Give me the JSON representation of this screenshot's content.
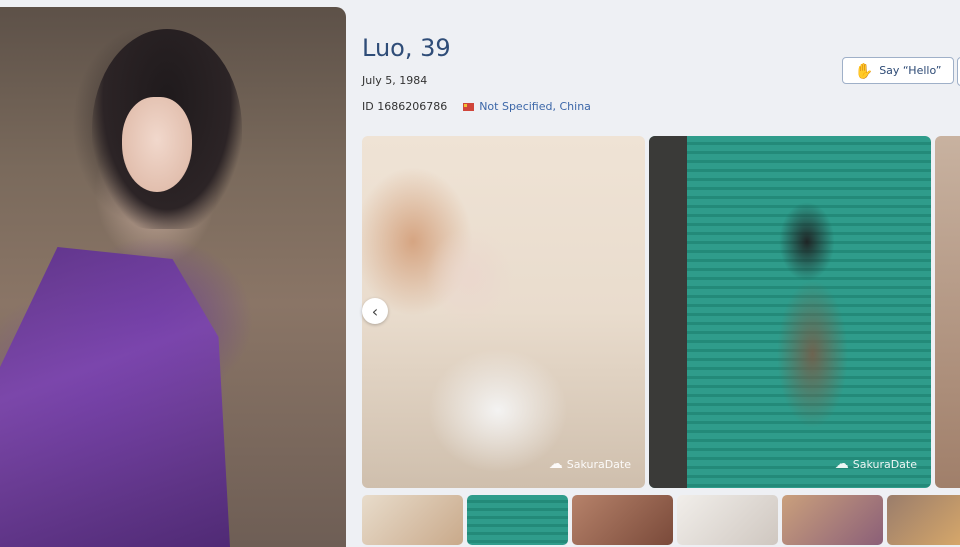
{
  "profile": {
    "name_age": "Luo, 39",
    "dob": "July 5, 1984",
    "id_text": "ID 1686206786",
    "location": "Not Specified, China"
  },
  "actions": {
    "say_hello": "Say “Hello”"
  },
  "gallery": {
    "watermark": "SakuraDate"
  },
  "icons": {
    "hello": "waving-hand-icon",
    "prev": "chevron-left-icon",
    "flag": "china-flag-icon",
    "watermark": "sakura-tree-icon"
  },
  "colors": {
    "name": "#2f4d78",
    "link": "#3c67a8",
    "button_border": "#9fb0c8"
  }
}
